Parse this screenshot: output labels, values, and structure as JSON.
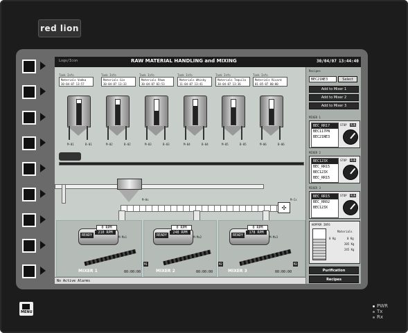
{
  "brand": "red lion",
  "header": {
    "left_text": "Logo/Icon",
    "title": "RAW MATERIAL HANDLING and MIXING",
    "date": "30/04/07",
    "time": "13:44:40"
  },
  "tanks": [
    {
      "hdr": "Tank Info",
      "material": "Materials  Vodka",
      "date": "30-04-07 13:57",
      "level": 0.85,
      "valves": [
        "M-01",
        "B-01"
      ]
    },
    {
      "hdr": "Tank Info",
      "material": "Materials  Gin",
      "date": "30-04-07 13:33",
      "level": 0.8,
      "valves": [
        "M-02",
        "B-02"
      ]
    },
    {
      "hdr": "Tank Info",
      "material": "Materials  Rhum",
      "date": "30-04-07 02:53",
      "level": 0.55,
      "valves": [
        "M-03",
        "B-03"
      ]
    },
    {
      "hdr": "Tank Info",
      "material": "Materials  Whisky",
      "date": "11-04-07 13:41",
      "level": 0.75,
      "valves": [
        "M-04",
        "B-04"
      ]
    },
    {
      "hdr": "Tank Info",
      "material": "Materials  Tequila",
      "date": "30-04-07 13:36",
      "level": 0.7,
      "valves": [
        "M-05",
        "B-05"
      ]
    },
    {
      "hdr": "Tank Info",
      "material": "Materials  Ricard",
      "date": "01-05-07 00:00",
      "level": 0.65,
      "valves": [
        "M-06",
        "B-06"
      ]
    }
  ],
  "fan_label": "M-Cs",
  "hopper_tag": "M-Hs",
  "mixers": [
    {
      "status": "READY",
      "rpm": "0 RPM",
      "rpm2": "210 RPM",
      "label": "MIXER 1",
      "time": "00:00:00",
      "tag": "M1",
      "mtag": "M-Mx1"
    },
    {
      "status": "READY",
      "rpm": "0 RPM",
      "rpm2": "248 RPM",
      "label": "MIXER 2",
      "time": "00:00:00",
      "tag": "M2",
      "mtag": "M-Mx2"
    },
    {
      "status": "READY",
      "rpm": "0 RPM",
      "rpm2": "178 RPM",
      "label": "MIXER 3",
      "time": "00:00:00",
      "tag": "M3",
      "mtag": "M-Mx3"
    }
  ],
  "status_bar": "No Active Alarms",
  "panel": {
    "recipes_label": "Recipes",
    "recipe_value": "BEC21NE3",
    "select_btn": "Select",
    "add_buttons": [
      "Add to Mixer 1",
      "Add to Mixer 2",
      "Add to Mixer 3"
    ],
    "mixer_panels": [
      {
        "label": "MIXER 1",
        "items": [
          "BEC_RR17",
          "BEC117PN",
          "BEC21NE3"
        ],
        "stop": "STOP",
        "run": "RUN"
      },
      {
        "label": "MIXER 2",
        "items": [
          "BEC123X",
          "BEC_RR15",
          "BEC123X",
          "BEC_RR15"
        ],
        "stop": "STOP",
        "run": "RUN"
      },
      {
        "label": "MIXER 3",
        "items": [
          "BEC_RR15",
          "BEC_RR02",
          "BEC123X"
        ],
        "stop": "STOP",
        "run": "RUN"
      }
    ],
    "hopper_info_label": "HOPPER INFO",
    "hopper_materials_label": "Materials",
    "hopper_values": [
      "0 Kg",
      "0 Kg",
      "205 Kg",
      "245 Kg"
    ],
    "purification_btn": "Purification",
    "recipes_btn": "Recipes"
  },
  "menu_label": "MENU",
  "leds": [
    "PWR",
    "Tx",
    "Rx"
  ]
}
